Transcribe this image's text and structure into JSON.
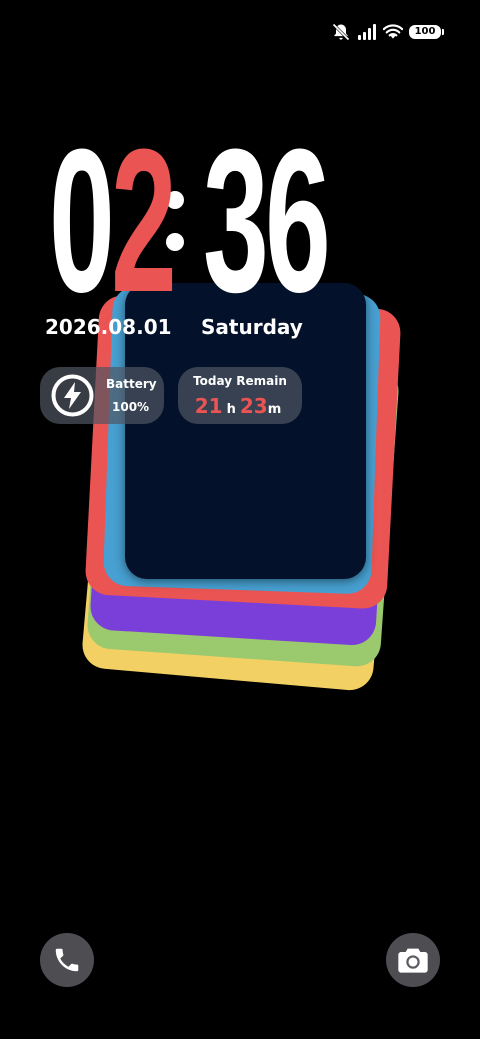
{
  "status_bar": {
    "icons": [
      "silent-bell-icon",
      "signal-icon",
      "wifi-icon",
      "battery-icon"
    ],
    "battery_level": "100"
  },
  "clock": {
    "digits": [
      "0",
      "2",
      "3",
      "6"
    ],
    "accent_digit_index": 1
  },
  "date": {
    "date_text": "2026.08.01",
    "weekday": "Saturday"
  },
  "battery_widget": {
    "icon": "charging-bolt-icon",
    "label": "Battery",
    "value": "100%"
  },
  "remain_widget": {
    "label": "Today Remain",
    "hours": "21",
    "hours_unit": "h",
    "minutes": "23",
    "minutes_unit": "m"
  },
  "shortcuts": {
    "left_icon": "phone-icon",
    "right_icon": "camera-icon"
  },
  "colors": {
    "accent": "#ea5453",
    "card_yellow": "#f2d064",
    "card_green": "#9bc96e",
    "card_purple": "#7b3fd9",
    "card_red": "#ea5453",
    "card_blue": "#47a0d1",
    "card_navy": "#03112a"
  }
}
